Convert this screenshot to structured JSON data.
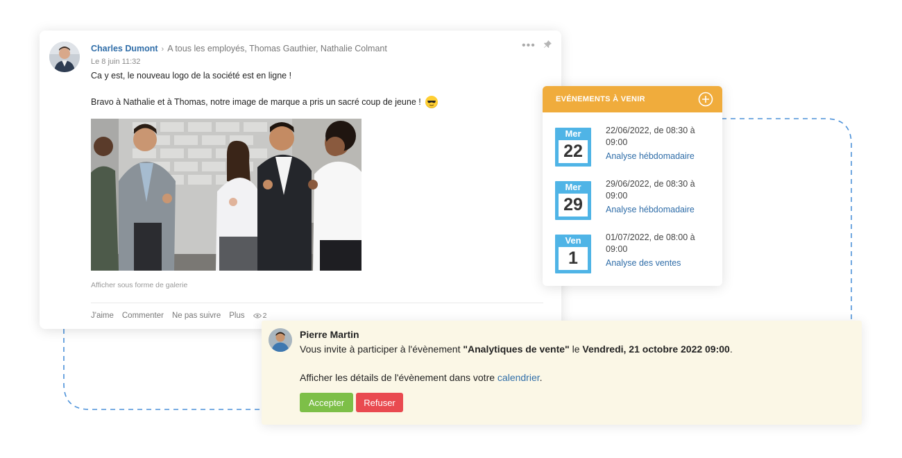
{
  "post": {
    "author": "Charles Dumont",
    "recipients": "A tous les employés, Thomas Gauthier, Nathalie Colmant",
    "date": "Le 8 juin 11:32",
    "line1": "Ca y est, le nouveau logo de la société est en ligne !",
    "line2": "Bravo à Nathalie et à Thomas, notre image de marque a pris un sacré coup de jeune !",
    "gallery_link": "Afficher sous forme de galerie",
    "actions": {
      "like": "J'aime",
      "comment": "Commenter",
      "unfollow": "Ne pas suivre",
      "more": "Plus",
      "views": "2"
    }
  },
  "events": {
    "header": "EVÉNEMENTS À VENIR",
    "items": [
      {
        "day": "Mer",
        "num": "22",
        "date": "22/06/2022, de 08:30 à 09:00",
        "title": "Analyse hébdomadaire"
      },
      {
        "day": "Mer",
        "num": "29",
        "date": "29/06/2022, de 08:30 à 09:00",
        "title": "Analyse hébdomadaire"
      },
      {
        "day": "Ven",
        "num": "1",
        "date": "01/07/2022, de 08:00 à 09:00",
        "title": "Analyse des ventes"
      }
    ]
  },
  "invite": {
    "name": "Pierre Martin",
    "text_prefix": "Vous invite à participer à l'évènement ",
    "event_name": "\"Analytiques de vente\"",
    "text_mid": " le ",
    "event_date": "Vendredi, 21 octobre 2022 09:00",
    "text_suffix": ".",
    "details_prefix": "Afficher les détails de l'évènement dans votre ",
    "details_link": "calendrier",
    "details_suffix": ".",
    "accept_label": "Accepter",
    "refuse_label": "Refuser"
  },
  "colors": {
    "link_blue": "#2f6da8",
    "events_header": "#f0ac3c",
    "calendar_blue": "#4fb4e6",
    "accept_green": "#7dbf48",
    "refuse_red": "#e94a50",
    "invite_bg": "#fbf7e6",
    "dashed_line": "#4a90d9"
  }
}
